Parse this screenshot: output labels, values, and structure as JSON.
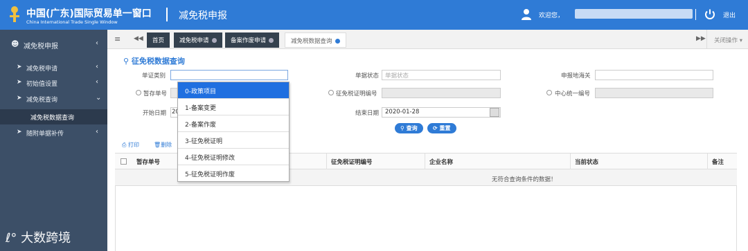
{
  "header": {
    "title": "中国(广东)国际贸易单一窗口",
    "subtitle": "China International Trade Single Window",
    "module": "减免税申报",
    "welcome": "欢迎您，",
    "logout": "退出"
  },
  "sidebar": {
    "root": "减免税申报",
    "items": [
      {
        "label": "减免税申请"
      },
      {
        "label": "初始值设置"
      },
      {
        "label": "减免税查询"
      },
      {
        "label": "减免税数据查询"
      },
      {
        "label": "随附单据补传"
      }
    ]
  },
  "tabs": {
    "home": "首页",
    "t1": "减免税申请",
    "t2": "备案作废申请",
    "t3": "减免税数据查询",
    "close_ops": "关闭操作"
  },
  "form": {
    "title": "征免税数据查询",
    "doc_type_label": "单证类别",
    "status_label": "单据状态",
    "status_placeholder": "单据状态",
    "customs_label": "申报地海关",
    "temp_no_label": "暂存单号",
    "cert_no_label": "征免税证明编号",
    "center_no_label": "中心统一编号",
    "start_label": "开始日期",
    "start_value": "20",
    "end_label": "结束日期",
    "end_value": "2020-01-28",
    "query_btn": "查询",
    "reset_btn": "重置"
  },
  "dropdown": {
    "options": [
      "0-政策项目",
      "1-备案变更",
      "2-备案作废",
      "3-征免税证明",
      "4-征免税证明修改",
      "5-征免税证明作废"
    ],
    "selected": "0-政策项目"
  },
  "toolbar": {
    "print": "打印",
    "delete": "删除"
  },
  "table": {
    "columns": [
      "暂存单号",
      "征免税证明编号",
      "企业名称",
      "当前状态",
      "备注"
    ],
    "empty": "无符合查询条件的数据！"
  },
  "watermark": "大数跨境",
  "colors": {
    "header": "#2f7bd6",
    "sidebar": "#3c4f67",
    "selected": "#1f6fe0"
  }
}
